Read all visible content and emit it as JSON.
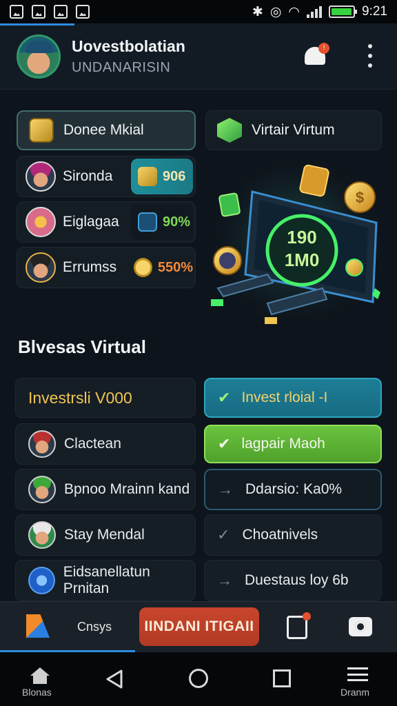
{
  "status_bar": {
    "time": "9:21",
    "battery_level": 0.95
  },
  "header": {
    "title": "Uovestbolatian",
    "subtitle": "UNDANARISIN",
    "notification_badge": "!"
  },
  "top_cards": {
    "left_header": "Donee Mkial",
    "right_header": "Virtair Virtum",
    "rows": [
      {
        "name": "Sironda",
        "value": "906"
      },
      {
        "name": "Eiglagaa",
        "value": "90%"
      },
      {
        "name": "Errumss",
        "value": "550%"
      }
    ]
  },
  "illustration": {
    "screen_text_line1": "190",
    "screen_text_line2": "1M0"
  },
  "section": {
    "title": "Blvesas Virtual",
    "left_header": "Investrsli V000",
    "right_header": "Invest rloial  -I",
    "left_items": [
      "Clactean",
      "Bpnoo Mrainn kand",
      "Stay Mendal",
      "Eidsanellatun Prnitan"
    ],
    "right_items": [
      "lagpair Maoh",
      "Ddarsio: Ka0%",
      "Choatnivels",
      "Duestaus loy 6b"
    ]
  },
  "action_bar": {
    "tab_label": "Cnsys",
    "primary_button": "IINDANI ITIGAII"
  },
  "nav": {
    "left_label": "Blonas",
    "right_label": "Dranm"
  },
  "colors": {
    "accent_blue": "#2d8de0",
    "teal": "#1f8f99",
    "green": "#5fb836",
    "gold": "#f1c552",
    "danger": "#c9452c"
  }
}
